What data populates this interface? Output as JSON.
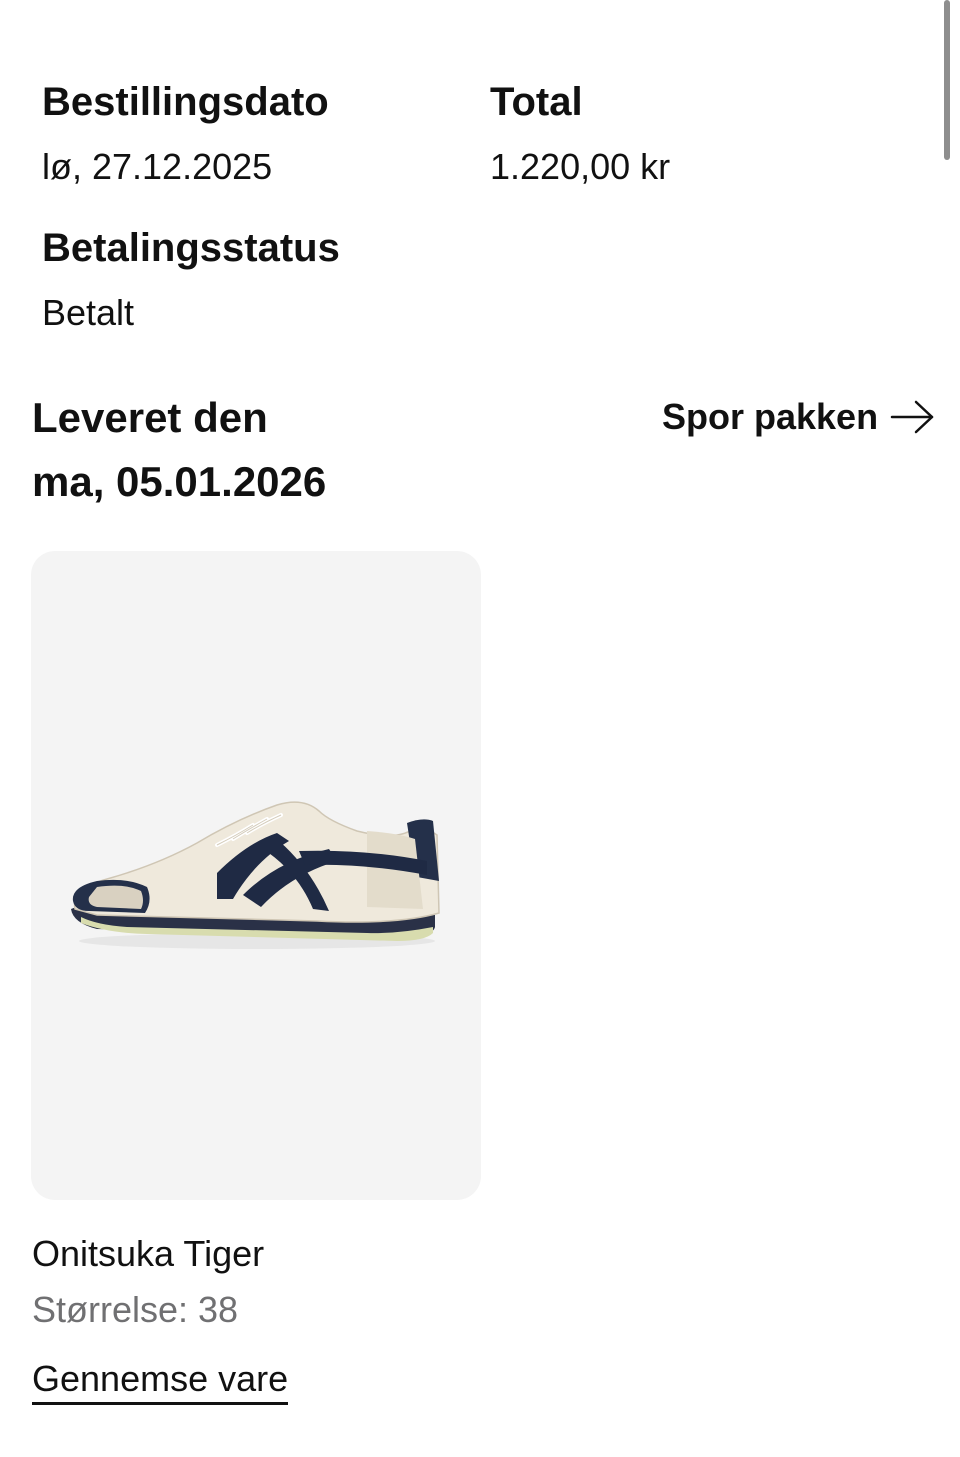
{
  "order": {
    "date_label": "Bestillingsdato",
    "date_value": "lø, 27.12.2025",
    "total_label": "Total",
    "total_value": "1.220,00 kr",
    "payment_status_label": "Betalingsstatus",
    "payment_status_value": "Betalt"
  },
  "delivery": {
    "line1": "Leveret den",
    "line2": "ma, 05.01.2026",
    "track_label": "Spor pakken",
    "track_icon": "arrow-right-icon"
  },
  "product": {
    "image_icon": "sneaker-image",
    "name": "Onitsuka Tiger",
    "size": "Størrelse: 38",
    "browse_label": "Gennemse vare"
  },
  "colors": {
    "text": "#111111",
    "muted_text": "#707072",
    "card_background": "#f4f4f4",
    "shoe_stripes": "#1f2a44",
    "shoe_upper": "#efe9dc"
  }
}
